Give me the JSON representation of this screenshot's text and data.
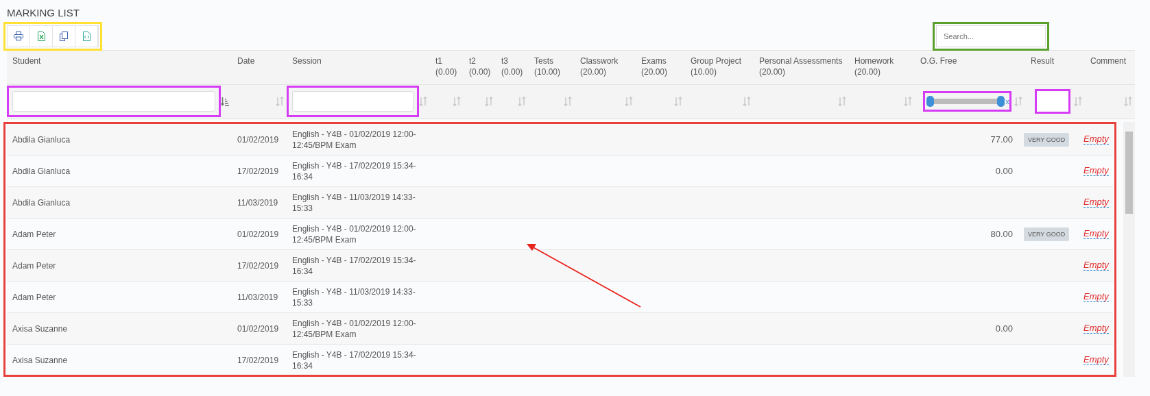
{
  "page": {
    "title": "MARKING LIST"
  },
  "toolbar": {
    "highlight": {
      "color": "#ffe033"
    },
    "buttons": [
      {
        "kind": "print"
      },
      {
        "kind": "excel"
      },
      {
        "kind": "copy"
      },
      {
        "kind": "csv"
      }
    ]
  },
  "search": {
    "placeholder": "Search...",
    "highlight": {
      "color": "#5aa02c"
    }
  },
  "table": {
    "columns": [
      {
        "label": "Student",
        "sorted": true,
        "filter": {
          "kind": "text",
          "highlight": {
            "color": "#d63cf5"
          }
        }
      },
      {
        "label": "Date",
        "sorted": false
      },
      {
        "label": "Session",
        "sorted": false,
        "filter": {
          "kind": "text",
          "highlight": {
            "color": "#d63cf5"
          }
        }
      },
      {
        "label": "t1 (0.00)",
        "sorted": false
      },
      {
        "label": "t2 (0.00)",
        "sorted": false
      },
      {
        "label": "t3 (0.00)",
        "sorted": false
      },
      {
        "label": "Tests (10.00)",
        "sorted": false
      },
      {
        "label": "Classwork (20.00)",
        "sorted": false
      },
      {
        "label": "Exams (20.00)",
        "sorted": false
      },
      {
        "label": "Group Project (10.00)",
        "sorted": false
      },
      {
        "label": "Personal Assessments (20.00)",
        "sorted": false
      },
      {
        "label": "Homework (20.00)",
        "sorted": false
      },
      {
        "label": "O.G. Free",
        "sorted": false,
        "filter": {
          "kind": "range",
          "level": 1,
          "clear": "x",
          "highlight": {
            "color": "#d63cf5"
          }
        }
      },
      {
        "label": "Result",
        "sorted": false,
        "filter": {
          "kind": "small",
          "highlight": {
            "color": "#d63cf5"
          }
        }
      },
      {
        "label": "Comment",
        "sorted": false
      }
    ],
    "highlight": {
      "color": "#e8413c"
    },
    "rows": [
      {
        "student": "Abdila Gianluca",
        "date": "01/02/2019",
        "session": "English - Y4B - 01/02/2019 12:00-12:45/BPM Exam",
        "og_free": "77.00",
        "result": "VERY GOOD",
        "comment": "Empty"
      },
      {
        "student": "Abdila Gianluca",
        "date": "17/02/2019",
        "session": "English - Y4B - 17/02/2019 15:34-16:34",
        "og_free": "0.00",
        "comment": "Empty"
      },
      {
        "student": "Abdila Gianluca",
        "date": "11/03/2019",
        "session": "English - Y4B - 11/03/2019 14:33-15:33",
        "comment": "Empty"
      },
      {
        "student": "Adam Peter",
        "date": "01/02/2019",
        "session": "English - Y4B - 01/02/2019 12:00-12:45/BPM Exam",
        "og_free": "80.00",
        "result": "VERY GOOD",
        "comment": "Empty"
      },
      {
        "student": "Adam Peter",
        "date": "17/02/2019",
        "session": "English - Y4B - 17/02/2019 15:34-16:34",
        "comment": "Empty"
      },
      {
        "student": "Adam Peter",
        "date": "11/03/2019",
        "session": "English - Y4B - 11/03/2019 14:33-15:33",
        "comment": "Empty"
      },
      {
        "student": "Axisa Suzanne",
        "date": "01/02/2019",
        "session": "English - Y4B - 01/02/2019 12:00-12:45/BPM Exam",
        "og_free": "0.00",
        "comment": "Empty"
      },
      {
        "student": "Axisa Suzanne",
        "date": "17/02/2019",
        "session": "English - Y4B - 17/02/2019 15:34-16:34",
        "comment": "Empty"
      }
    ]
  },
  "arrow": {
    "color": "#e8231e"
  }
}
